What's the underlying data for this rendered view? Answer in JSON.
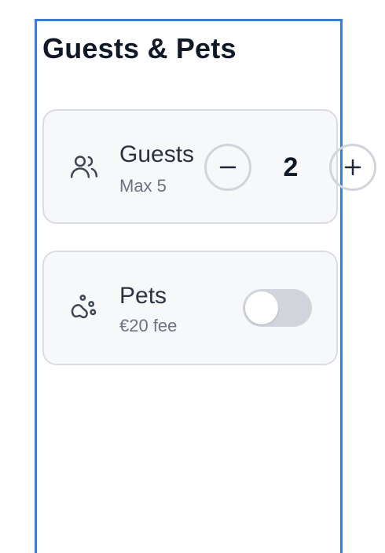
{
  "page": {
    "title": "Guests & Pets"
  },
  "guests": {
    "label": "Guests",
    "sublabel": "Max 5",
    "count": "2",
    "icon": "users-icon",
    "decrement_icon": "minus-icon",
    "increment_icon": "plus-icon"
  },
  "pets": {
    "label": "Pets",
    "sublabel": "€20 fee",
    "icon": "paw-icon",
    "toggle_on": false
  },
  "colors": {
    "panel_border": "#3b7dd8",
    "card_bg": "#f7f8fa",
    "card_border": "#d9dce2",
    "toggle_off": "#d1d5db"
  }
}
